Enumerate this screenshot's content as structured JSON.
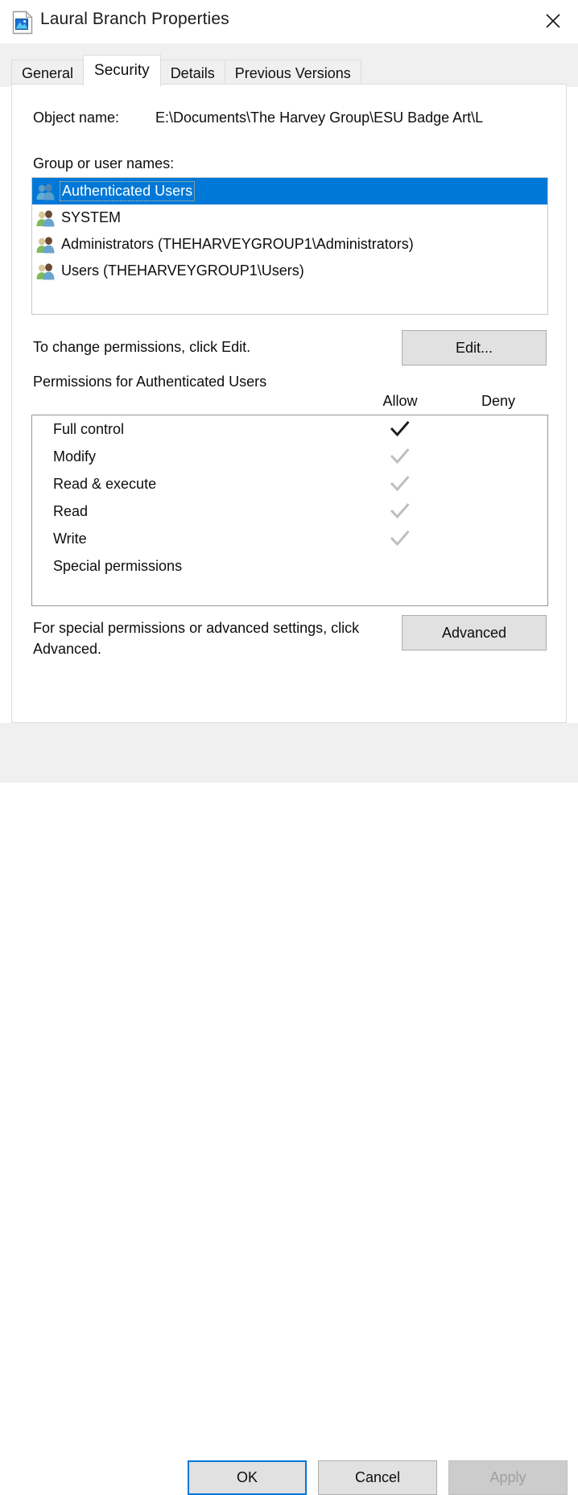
{
  "window": {
    "title": "Laural Branch Properties",
    "icon": "image-file-icon",
    "close_icon": "close-icon"
  },
  "tabs": [
    {
      "label": "General",
      "active": false
    },
    {
      "label": "Security",
      "active": true
    },
    {
      "label": "Details",
      "active": false
    },
    {
      "label": "Previous Versions",
      "active": false
    }
  ],
  "security": {
    "object_name_label": "Object name:",
    "object_name_value": "E:\\Documents\\The Harvey Group\\ESU Badge Art\\L",
    "group_label": "Group or user names:",
    "group_list": [
      {
        "name": "Authenticated Users",
        "icon": "users-group-icon",
        "selected": true
      },
      {
        "name": "SYSTEM",
        "icon": "users-group-icon",
        "selected": false
      },
      {
        "name": "Administrators (THEHARVEYGROUP1\\Administrators)",
        "icon": "users-group-icon",
        "selected": false
      },
      {
        "name": "Users (THEHARVEYGROUP1\\Users)",
        "icon": "users-group-icon",
        "selected": false
      }
    ],
    "edit_hint": "To change permissions, click Edit.",
    "edit_button": "Edit...",
    "permissions_title": "Permissions for Authenticated Users",
    "column_allow": "Allow",
    "column_deny": "Deny",
    "permissions": [
      {
        "name": "Full control",
        "allow": "checked",
        "deny": "none"
      },
      {
        "name": "Modify",
        "allow": "inherited",
        "deny": "none"
      },
      {
        "name": "Read & execute",
        "allow": "inherited",
        "deny": "none"
      },
      {
        "name": "Read",
        "allow": "inherited",
        "deny": "none"
      },
      {
        "name": "Write",
        "allow": "inherited",
        "deny": "none"
      },
      {
        "name": "Special permissions",
        "allow": "none",
        "deny": "none"
      }
    ],
    "advanced_hint": "For special permissions or advanced settings, click Advanced.",
    "advanced_button": "Advanced"
  },
  "footer": {
    "ok": "OK",
    "cancel": "Cancel",
    "apply": "Apply",
    "apply_disabled": true
  },
  "colors": {
    "selection_blue": "#0078D7",
    "dialog_background": "#FFFFFF",
    "chrome_background": "#F0F0F0",
    "button_face": "#E1E1E1",
    "check_active": "#1A1A1A",
    "check_inherited": "#BDBDBD"
  }
}
